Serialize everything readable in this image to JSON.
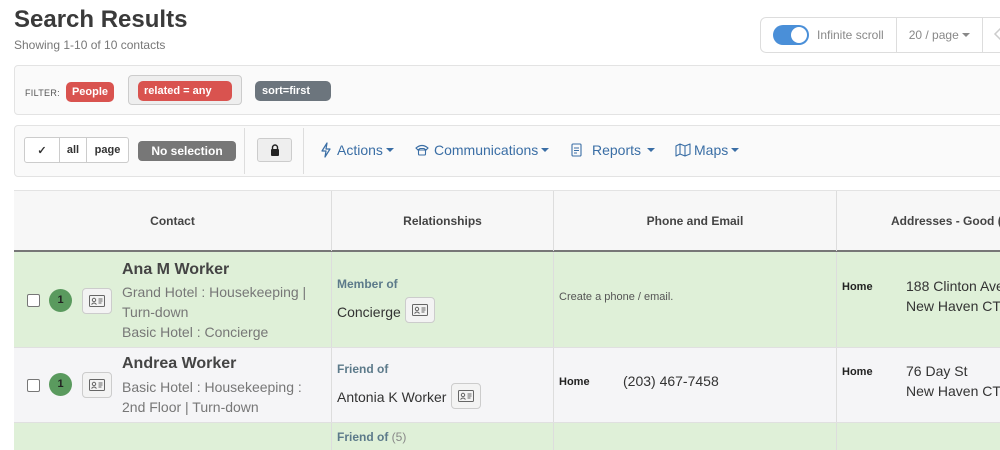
{
  "page": {
    "title": "Search Results",
    "subtitle": "Showing 1-10 of 10 contacts"
  },
  "topbar": {
    "infinite_scroll_label": "Infinite scroll",
    "per_page_label": "20 / page"
  },
  "filter": {
    "label": "FILTER:",
    "pills": [
      "People",
      "related = any",
      "sort=first"
    ]
  },
  "toolbar": {
    "select_check": "✓",
    "select_all": "all",
    "select_page": "page",
    "no_selection": "No selection",
    "menus": {
      "actions": "Actions",
      "communications": "Communications",
      "reports": "Reports",
      "maps": "Maps"
    }
  },
  "table": {
    "headers": [
      "Contact",
      "Relationships",
      "Phone and Email",
      "Addresses - Good ("
    ],
    "rows": [
      {
        "badge": "1",
        "name": "Ana M Worker",
        "meta1": "Grand Hotel : Housekeeping |",
        "meta2": "Turn-down",
        "meta3": "Basic Hotel : Concierge",
        "rel_label": "Member of",
        "rel_value": "Concierge",
        "contact_info": "Create a phone / email.",
        "addr_type": "Home",
        "addr_line1": "188 Clinton Ave",
        "addr_line2": "New Haven CT"
      },
      {
        "badge": "1",
        "name": "Andrea Worker",
        "meta1": "Basic Hotel : Housekeeping :",
        "meta2": "2nd Floor | Turn-down",
        "rel_label": "Friend of",
        "rel_value": "Antonia K Worker",
        "phone_type": "Home",
        "phone": "(203) 467-7458",
        "addr_type": "Home",
        "addr_line1": "76 Day St",
        "addr_line2": "New Haven CT"
      },
      {
        "rel_label": "Friend of",
        "rel_count": "(5)"
      }
    ]
  },
  "colors": {
    "accent_blue": "#4a8fd8",
    "danger_red": "#d9534f",
    "row_green": "#dff0d8",
    "badge_green": "#5a9a5e"
  }
}
